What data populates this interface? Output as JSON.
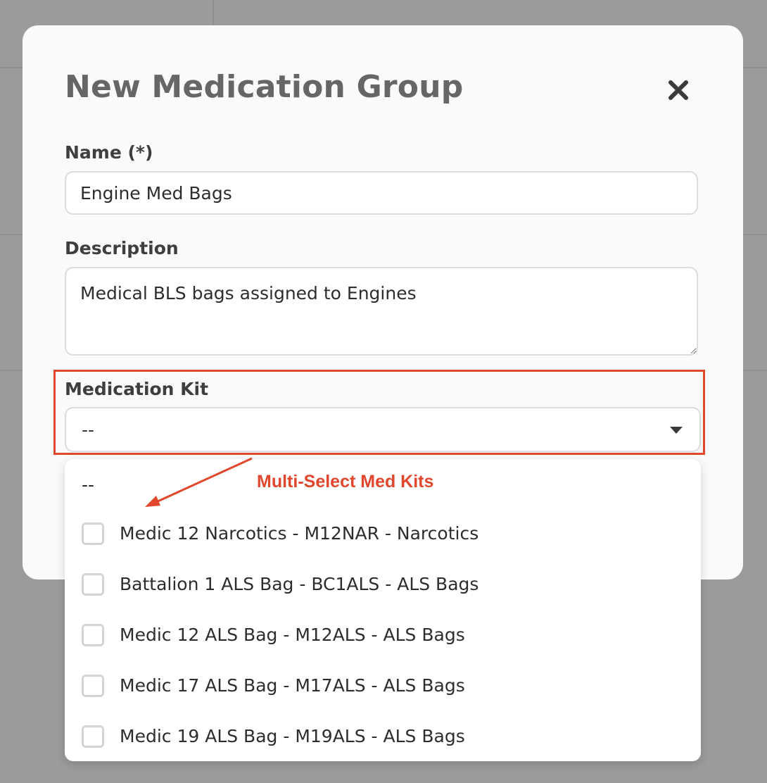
{
  "modal": {
    "title": "New Medication Group",
    "close_icon": "close-icon"
  },
  "form": {
    "name_label": "Name (*)",
    "name_value": "Engine Med Bags",
    "description_label": "Description",
    "description_value": "Medical BLS bags assigned to Engines",
    "kit_label": "Medication Kit",
    "kit_selected": "--"
  },
  "dropdown": {
    "empty_option": "--",
    "options": [
      {
        "label": "Medic 12 Narcotics - M12NAR - Narcotics",
        "checked": false
      },
      {
        "label": "Battalion 1 ALS Bag - BC1ALS - ALS Bags",
        "checked": false
      },
      {
        "label": "Medic 12 ALS Bag - M12ALS - ALS Bags",
        "checked": false
      },
      {
        "label": "Medic 17 ALS Bag - M17ALS - ALS Bags",
        "checked": false
      },
      {
        "label": "Medic 19 ALS Bag - M19ALS - ALS Bags",
        "checked": false
      }
    ]
  },
  "annotation": {
    "text": "Multi-Select Med Kits",
    "color": "#e0472d"
  },
  "colors": {
    "overlay": "#9b9b9b",
    "modal_bg": "#fafafa",
    "title": "#666666",
    "accent": "#e0472d"
  }
}
